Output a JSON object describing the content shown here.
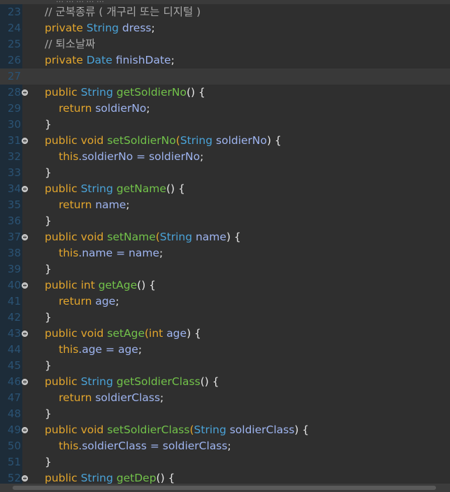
{
  "top_strip_text": "… … … … …",
  "lines": [
    {
      "no": "23",
      "indent": 1,
      "fold": false,
      "current": false,
      "tokens": [
        {
          "t": "// 군복종류 ( 개구리 또는 디지털 )",
          "c": "cm"
        }
      ]
    },
    {
      "no": "24",
      "indent": 1,
      "fold": false,
      "current": false,
      "tokens": [
        {
          "t": "private ",
          "c": "kw"
        },
        {
          "t": "String ",
          "c": "ty"
        },
        {
          "t": "dress",
          "c": "var"
        },
        {
          "t": ";",
          "c": "pl"
        }
      ]
    },
    {
      "no": "25",
      "indent": 1,
      "fold": false,
      "current": false,
      "tokens": [
        {
          "t": "// 퇴소날짜",
          "c": "cm"
        }
      ]
    },
    {
      "no": "26",
      "indent": 1,
      "fold": false,
      "current": false,
      "tokens": [
        {
          "t": "private ",
          "c": "kw"
        },
        {
          "t": "Date ",
          "c": "ty"
        },
        {
          "t": "finishDate",
          "c": "var"
        },
        {
          "t": ";",
          "c": "pl"
        }
      ]
    },
    {
      "no": "27",
      "indent": 1,
      "fold": false,
      "current": true,
      "tokens": []
    },
    {
      "no": "28",
      "indent": 1,
      "fold": true,
      "current": false,
      "tokens": [
        {
          "t": "public ",
          "c": "kw"
        },
        {
          "t": "String ",
          "c": "ty"
        },
        {
          "t": "getSoldierNo",
          "c": "fn"
        },
        {
          "t": "() {",
          "c": "pl"
        }
      ]
    },
    {
      "no": "29",
      "indent": 2,
      "fold": false,
      "current": false,
      "tokens": [
        {
          "t": "return ",
          "c": "kw"
        },
        {
          "t": "soldierNo",
          "c": "var"
        },
        {
          "t": ";",
          "c": "pl"
        }
      ]
    },
    {
      "no": "30",
      "indent": 1,
      "fold": false,
      "current": false,
      "tokens": [
        {
          "t": "}",
          "c": "pl"
        }
      ]
    },
    {
      "no": "31",
      "indent": 1,
      "fold": true,
      "current": false,
      "tokens": [
        {
          "t": "public ",
          "c": "kw"
        },
        {
          "t": "void ",
          "c": "kw"
        },
        {
          "t": "setSoldierNo",
          "c": "fn"
        },
        {
          "t": "(",
          "c": "kw"
        },
        {
          "t": "String ",
          "c": "ty"
        },
        {
          "t": "soldierNo",
          "c": "var"
        },
        {
          "t": ") {",
          "c": "pl"
        }
      ]
    },
    {
      "no": "32",
      "indent": 2,
      "fold": false,
      "current": false,
      "tokens": [
        {
          "t": "this",
          "c": "kw"
        },
        {
          "t": ".soldierNo = ",
          "c": "var"
        },
        {
          "t": "soldierNo",
          "c": "var"
        },
        {
          "t": ";",
          "c": "pl"
        }
      ]
    },
    {
      "no": "33",
      "indent": 1,
      "fold": false,
      "current": false,
      "tokens": [
        {
          "t": "}",
          "c": "pl"
        }
      ]
    },
    {
      "no": "34",
      "indent": 1,
      "fold": true,
      "current": false,
      "tokens": [
        {
          "t": "public ",
          "c": "kw"
        },
        {
          "t": "String ",
          "c": "ty"
        },
        {
          "t": "getName",
          "c": "fn"
        },
        {
          "t": "() {",
          "c": "pl"
        }
      ]
    },
    {
      "no": "35",
      "indent": 2,
      "fold": false,
      "current": false,
      "tokens": [
        {
          "t": "return ",
          "c": "kw"
        },
        {
          "t": "name",
          "c": "var"
        },
        {
          "t": ";",
          "c": "pl"
        }
      ]
    },
    {
      "no": "36",
      "indent": 1,
      "fold": false,
      "current": false,
      "tokens": [
        {
          "t": "}",
          "c": "pl"
        }
      ]
    },
    {
      "no": "37",
      "indent": 1,
      "fold": true,
      "current": false,
      "tokens": [
        {
          "t": "public ",
          "c": "kw"
        },
        {
          "t": "void ",
          "c": "kw"
        },
        {
          "t": "setName",
          "c": "fn"
        },
        {
          "t": "(",
          "c": "kw"
        },
        {
          "t": "String ",
          "c": "ty"
        },
        {
          "t": "name",
          "c": "var"
        },
        {
          "t": ") {",
          "c": "pl"
        }
      ]
    },
    {
      "no": "38",
      "indent": 2,
      "fold": false,
      "current": false,
      "tokens": [
        {
          "t": "this",
          "c": "kw"
        },
        {
          "t": ".name = ",
          "c": "var"
        },
        {
          "t": "name",
          "c": "var"
        },
        {
          "t": ";",
          "c": "pl"
        }
      ]
    },
    {
      "no": "39",
      "indent": 1,
      "fold": false,
      "current": false,
      "tokens": [
        {
          "t": "}",
          "c": "pl"
        }
      ]
    },
    {
      "no": "40",
      "indent": 1,
      "fold": true,
      "current": false,
      "tokens": [
        {
          "t": "public ",
          "c": "kw"
        },
        {
          "t": "int ",
          "c": "kw"
        },
        {
          "t": "getAge",
          "c": "fn"
        },
        {
          "t": "() {",
          "c": "pl"
        }
      ]
    },
    {
      "no": "41",
      "indent": 2,
      "fold": false,
      "current": false,
      "tokens": [
        {
          "t": "return ",
          "c": "kw"
        },
        {
          "t": "age",
          "c": "var"
        },
        {
          "t": ";",
          "c": "pl"
        }
      ]
    },
    {
      "no": "42",
      "indent": 1,
      "fold": false,
      "current": false,
      "tokens": [
        {
          "t": "}",
          "c": "pl"
        }
      ]
    },
    {
      "no": "43",
      "indent": 1,
      "fold": true,
      "current": false,
      "tokens": [
        {
          "t": "public ",
          "c": "kw"
        },
        {
          "t": "void ",
          "c": "kw"
        },
        {
          "t": "setAge",
          "c": "fn"
        },
        {
          "t": "(",
          "c": "kw"
        },
        {
          "t": "int ",
          "c": "kw"
        },
        {
          "t": "age",
          "c": "var"
        },
        {
          "t": ") {",
          "c": "pl"
        }
      ]
    },
    {
      "no": "44",
      "indent": 2,
      "fold": false,
      "current": false,
      "tokens": [
        {
          "t": "this",
          "c": "kw"
        },
        {
          "t": ".age = ",
          "c": "var"
        },
        {
          "t": "age",
          "c": "var"
        },
        {
          "t": ";",
          "c": "pl"
        }
      ]
    },
    {
      "no": "45",
      "indent": 1,
      "fold": false,
      "current": false,
      "tokens": [
        {
          "t": "}",
          "c": "pl"
        }
      ]
    },
    {
      "no": "46",
      "indent": 1,
      "fold": true,
      "current": false,
      "tokens": [
        {
          "t": "public ",
          "c": "kw"
        },
        {
          "t": "String ",
          "c": "ty"
        },
        {
          "t": "getSoldierClass",
          "c": "fn"
        },
        {
          "t": "() {",
          "c": "pl"
        }
      ]
    },
    {
      "no": "47",
      "indent": 2,
      "fold": false,
      "current": false,
      "tokens": [
        {
          "t": "return ",
          "c": "kw"
        },
        {
          "t": "soldierClass",
          "c": "var"
        },
        {
          "t": ";",
          "c": "pl"
        }
      ]
    },
    {
      "no": "48",
      "indent": 1,
      "fold": false,
      "current": false,
      "tokens": [
        {
          "t": "}",
          "c": "pl"
        }
      ]
    },
    {
      "no": "49",
      "indent": 1,
      "fold": true,
      "current": false,
      "tokens": [
        {
          "t": "public ",
          "c": "kw"
        },
        {
          "t": "void ",
          "c": "kw"
        },
        {
          "t": "setSoldierClass",
          "c": "fn"
        },
        {
          "t": "(",
          "c": "kw"
        },
        {
          "t": "String ",
          "c": "ty"
        },
        {
          "t": "soldierClass",
          "c": "var"
        },
        {
          "t": ") {",
          "c": "pl"
        }
      ]
    },
    {
      "no": "50",
      "indent": 2,
      "fold": false,
      "current": false,
      "tokens": [
        {
          "t": "this",
          "c": "kw"
        },
        {
          "t": ".soldierClass = ",
          "c": "var"
        },
        {
          "t": "soldierClass",
          "c": "var"
        },
        {
          "t": ";",
          "c": "pl"
        }
      ]
    },
    {
      "no": "51",
      "indent": 1,
      "fold": false,
      "current": false,
      "tokens": [
        {
          "t": "}",
          "c": "pl"
        }
      ]
    },
    {
      "no": "52",
      "indent": 1,
      "fold": true,
      "current": false,
      "tokens": [
        {
          "t": "public ",
          "c": "kw"
        },
        {
          "t": "String ",
          "c": "ty"
        },
        {
          "t": "getDep",
          "c": "fn"
        },
        {
          "t": "() {",
          "c": "pl"
        }
      ]
    }
  ]
}
